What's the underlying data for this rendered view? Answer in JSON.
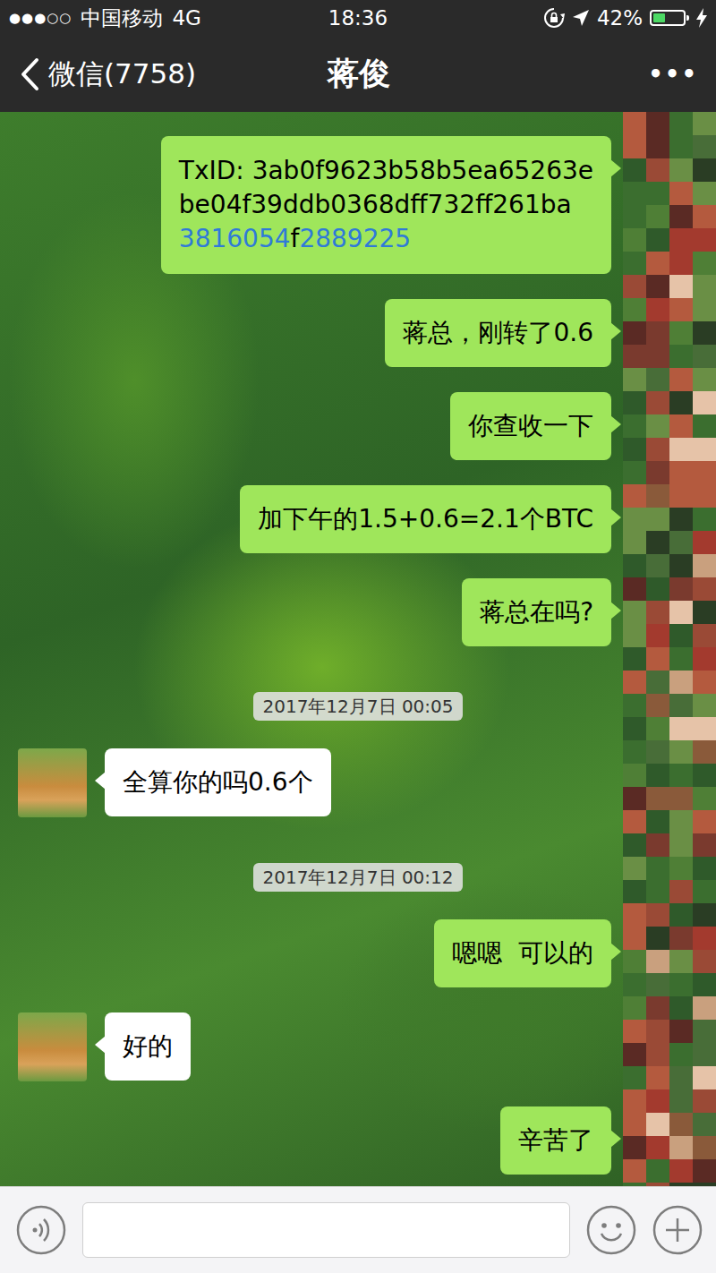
{
  "status_bar": {
    "signal": "●●●○○",
    "carrier": "中国移动",
    "network": "4G",
    "time": "18:36",
    "battery_text": "42%",
    "battery_level": 0.42,
    "charging": true
  },
  "nav": {
    "back": "微信(7758)",
    "title": "蒋俊",
    "more": "•••"
  },
  "messages": [
    {
      "kind": "sent",
      "lines": [
        [
          {
            "text": "TxID: 3ab0f9623b58b5ea65263e",
            "link": false
          }
        ],
        [
          {
            "text": "be04f39ddb0368dff732ff261ba",
            "link": false
          }
        ],
        [
          {
            "text": "3816054",
            "link": true
          },
          {
            "text": "f",
            "link": false
          },
          {
            "text": "2889225",
            "link": true
          }
        ]
      ]
    },
    {
      "kind": "sent",
      "text": "蒋总，刚转了0.6"
    },
    {
      "kind": "sent",
      "text": "你查收一下"
    },
    {
      "kind": "sent",
      "text": "加下午的1.5+0.6=2.1个BTC"
    },
    {
      "kind": "sent",
      "text": "蒋总在吗?"
    },
    {
      "kind": "time",
      "text": "2017年12月7日 00:05"
    },
    {
      "kind": "received",
      "text": "全算你的吗0.6个"
    },
    {
      "kind": "time",
      "text": "2017年12月7日 00:12"
    },
    {
      "kind": "sent",
      "text": "嗯嗯  可以的"
    },
    {
      "kind": "received",
      "text": "好的"
    },
    {
      "kind": "sent",
      "text": "辛苦了"
    }
  ]
}
